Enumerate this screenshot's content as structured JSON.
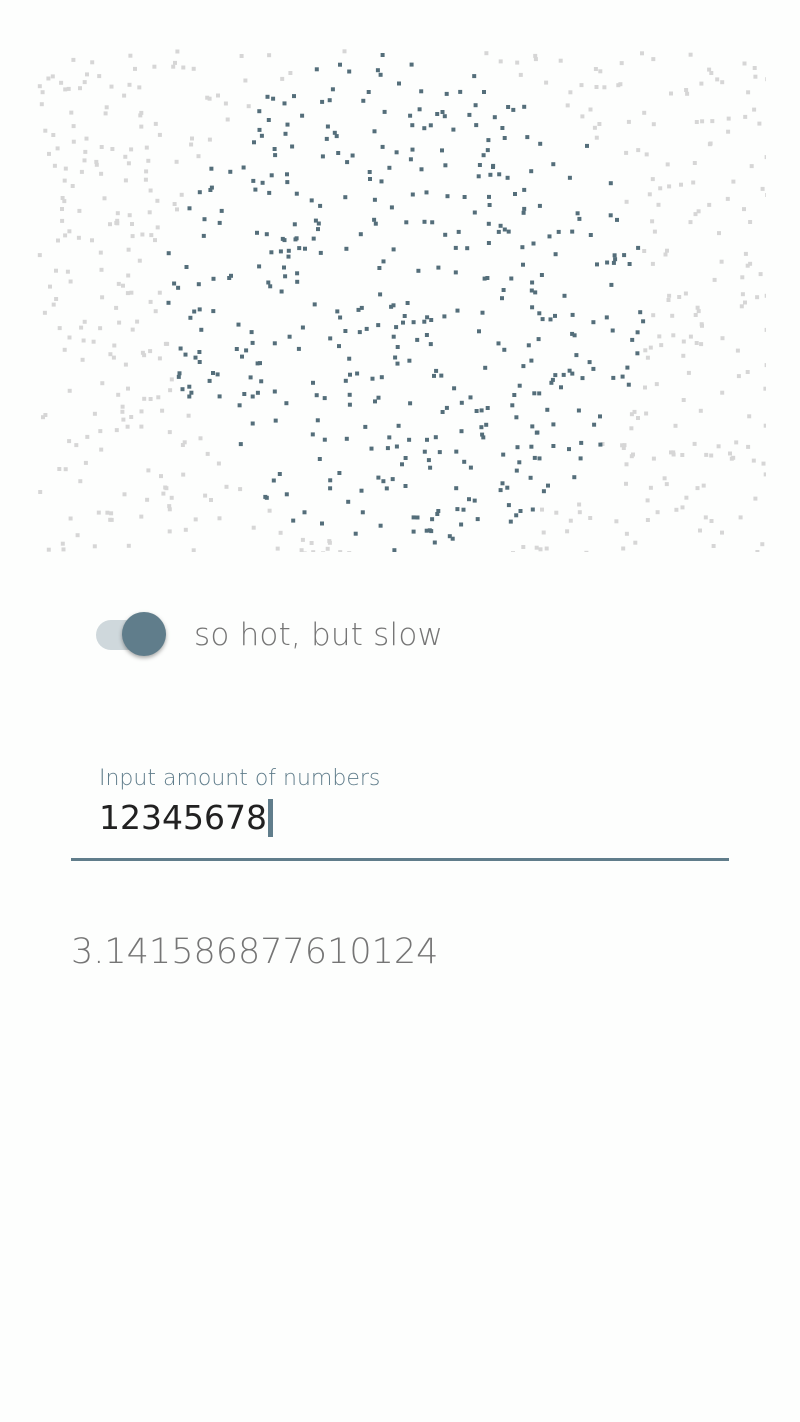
{
  "colors": {
    "background": "#fdfefd",
    "accent": "#607d8b",
    "inside_point": "#546e7a",
    "outside_point": "#d6d6d6",
    "switch_track": "#cfd8dc",
    "muted_text": "#757575"
  },
  "visualization": {
    "description_icon": "monte-carlo-points",
    "inside_color": "#546e7a",
    "outside_color": "#d6d6d6"
  },
  "toggle": {
    "state": "on",
    "label": "so hot, but slow"
  },
  "input": {
    "label": "Input amount of numbers",
    "value": "12345678"
  },
  "result": {
    "value": "3.141586877610124"
  }
}
